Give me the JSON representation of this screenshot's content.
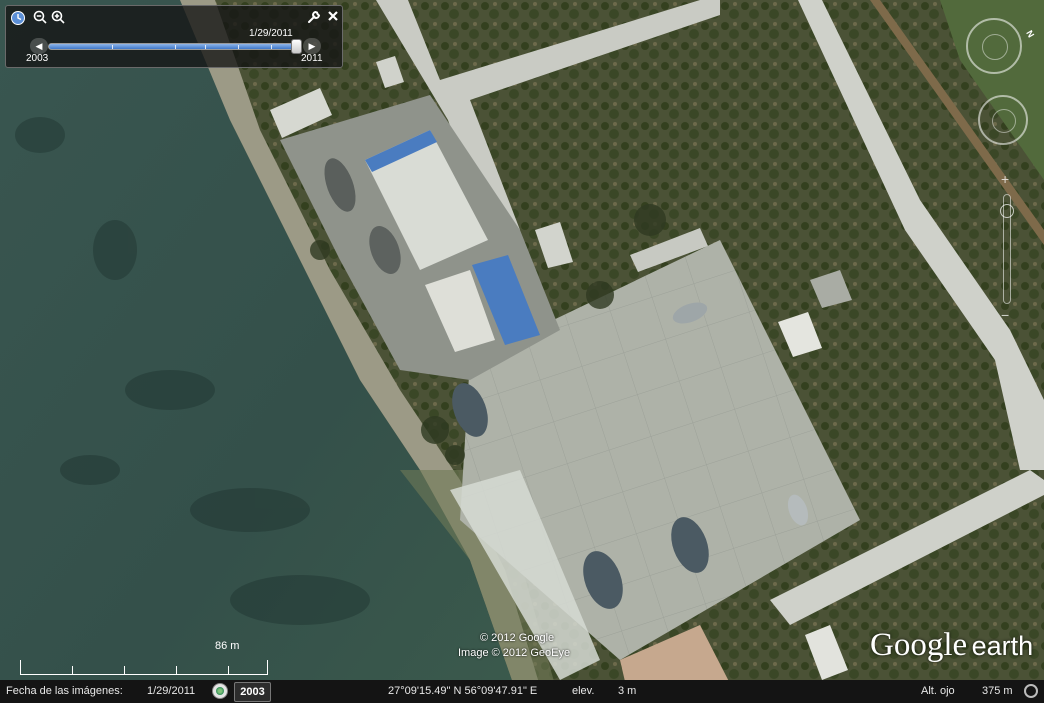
{
  "timebar": {
    "current_date": "1/29/2011",
    "start_year": "2003",
    "end_year": "2011",
    "position_fraction": 0.98
  },
  "map": {
    "copyright_google": "© 2012 Google",
    "copyright_imagery": "Image © 2012 GeoEye",
    "logo_google": "Google",
    "logo_earth": "earth",
    "compass_label": "N",
    "scale_label": "86 m"
  },
  "status": {
    "imagery_date_label": "Fecha de las imágenes:",
    "imagery_date": "1/29/2011",
    "year_button": "2003",
    "coordinates": "27°09'15.49\" N  56°09'47.91\" E",
    "elev_label": "elev.",
    "elev_value": "3 m",
    "eye_alt_label": "Alt. ojo",
    "eye_alt_value": "375 m"
  },
  "colors": {
    "water": "#2f4a45",
    "concrete": "#b9bdb3",
    "blue_roof": "#4a7cc0",
    "vegetation": "#3d4a2c"
  },
  "icons": [
    "clock-icon",
    "zoom-out-icon",
    "zoom-in-icon",
    "wrench-icon",
    "close-icon",
    "navigation-ring-icon",
    "zoom-slider-icon"
  ]
}
